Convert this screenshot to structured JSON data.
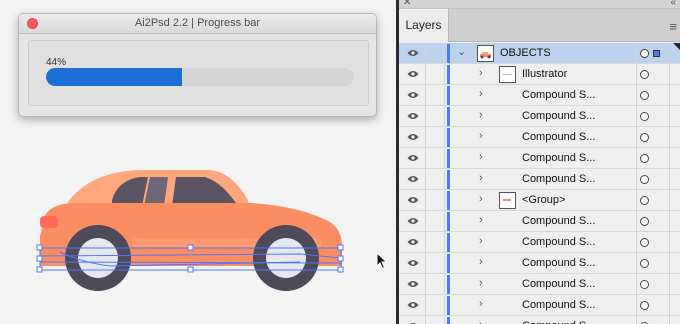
{
  "dialog": {
    "title": "Ai2Psd 2.2 | Progress bar",
    "progress_label": "44%",
    "progress_value": 0.44
  },
  "panel": {
    "tab": "Layers",
    "close_glyph": "✕",
    "collapse_glyph": "«",
    "menu_glyph": "≡"
  },
  "layers": [
    {
      "name": "OBJECTS",
      "indent": 0,
      "expanded": true,
      "thumb": "car-thumb-icon",
      "selected": true
    },
    {
      "name": "Illustrator",
      "indent": 1,
      "expanded": false,
      "thumb": "text-thumb-icon",
      "selected": false
    },
    {
      "name": "Compound S...",
      "indent": 1,
      "expanded": false,
      "thumb": null,
      "selected": false
    },
    {
      "name": "Compound S...",
      "indent": 1,
      "expanded": false,
      "thumb": null,
      "selected": false
    },
    {
      "name": "Compound S...",
      "indent": 1,
      "expanded": false,
      "thumb": null,
      "selected": false
    },
    {
      "name": "Compound S...",
      "indent": 1,
      "expanded": false,
      "thumb": null,
      "selected": false
    },
    {
      "name": "Compound S...",
      "indent": 1,
      "expanded": false,
      "thumb": null,
      "selected": false
    },
    {
      "name": "<Group>",
      "indent": 1,
      "expanded": false,
      "thumb": "group-thumb-icon",
      "selected": false
    },
    {
      "name": "Compound S...",
      "indent": 1,
      "expanded": false,
      "thumb": null,
      "selected": false
    },
    {
      "name": "Compound S...",
      "indent": 1,
      "expanded": false,
      "thumb": null,
      "selected": false
    },
    {
      "name": "Compound S...",
      "indent": 1,
      "expanded": false,
      "thumb": null,
      "selected": false
    },
    {
      "name": "Compound S...",
      "indent": 1,
      "expanded": false,
      "thumb": null,
      "selected": false
    },
    {
      "name": "Compound S...",
      "indent": 1,
      "expanded": false,
      "thumb": null,
      "selected": false
    },
    {
      "name": "Compound S...",
      "indent": 1,
      "expanded": false,
      "thumb": null,
      "selected": false
    }
  ],
  "colors": {
    "progress_fill": "#1b6fd6",
    "layer_color": "#4a78ff",
    "car_body": "#fa8d62",
    "car_roof": "#ffa77c",
    "car_window": "#5b5563",
    "wheel": "#4f4a57",
    "rim": "#e7e8ee",
    "selection": "#4a78ff"
  }
}
